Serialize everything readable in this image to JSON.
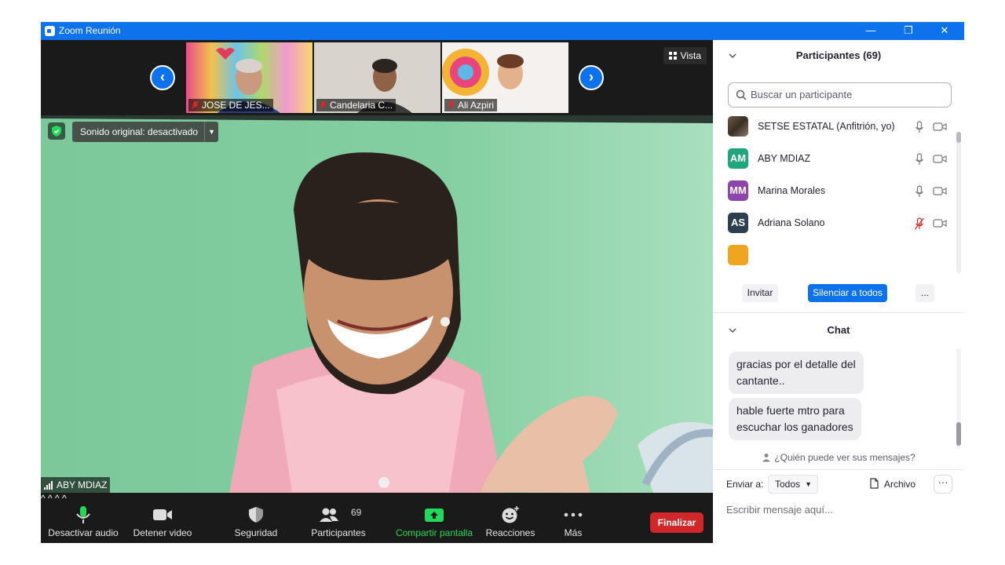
{
  "window": {
    "title": "Zoom Reunión",
    "controls": {
      "minimize": "—",
      "restore": "❐",
      "close": "✕"
    }
  },
  "strip": {
    "prev_arrow": "‹",
    "next_arrow": "›",
    "view_button": "Vista",
    "thumbnails": [
      {
        "name": "JOSE DE JES...",
        "muted": true
      },
      {
        "name": "Candelaria C...",
        "muted": true
      },
      {
        "name": "Ali Azpiri",
        "muted": true
      }
    ]
  },
  "main_video": {
    "original_sound": "Sonido original: desactivado",
    "speaker_name": "ABY MDIAZ"
  },
  "toolbar": {
    "mute_label": "Desactivar audio",
    "video_label": "Detener video",
    "security_label": "Seguridad",
    "participants_label": "Participantes",
    "participants_count": "69",
    "share_label": "Compartir pantalla",
    "reactions_label": "Reacciones",
    "more_label": "Más",
    "end_label": "Finalizar",
    "caret": "^"
  },
  "participants_panel": {
    "title": "Participantes (69)",
    "search_placeholder": "Buscar un participante",
    "rows": [
      {
        "initials": "",
        "name": "SETSE ESTATAL (Anfitrión, yo)",
        "avatar_color": "#5a4a3a",
        "mic_muted": false
      },
      {
        "initials": "AM",
        "name": "ABY MDIAZ",
        "avatar_color": "#1fa67a",
        "mic_muted": false
      },
      {
        "initials": "MM",
        "name": "Marina Morales",
        "avatar_color": "#8e44ad",
        "mic_muted": false
      },
      {
        "initials": "AS",
        "name": "Adriana Solano",
        "avatar_color": "#2c3e50",
        "mic_muted": true
      }
    ],
    "invite_label": "Invitar",
    "mute_all_label": "Silenciar a todos",
    "more_label": "..."
  },
  "chat_panel": {
    "title": "Chat",
    "messages": [
      {
        "line1": "gracias por el detalle del",
        "line2": "cantante.."
      },
      {
        "line1": "hable fuerte mtro para",
        "line2": "escuchar los ganadores"
      }
    ],
    "who_can_see": "¿Quién puede ver sus mensajes?",
    "send_to_label": "Enviar a:",
    "send_to_value": "Todos",
    "file_label": "Archivo",
    "more_label": "···",
    "input_placeholder": "Escribir mensaje aquí..."
  },
  "colors": {
    "title_bar": "#0e72ed",
    "accent_blue": "#0e72ed",
    "end_red": "#d1272a",
    "share_green": "#23d959",
    "muted_red": "#e02828"
  }
}
